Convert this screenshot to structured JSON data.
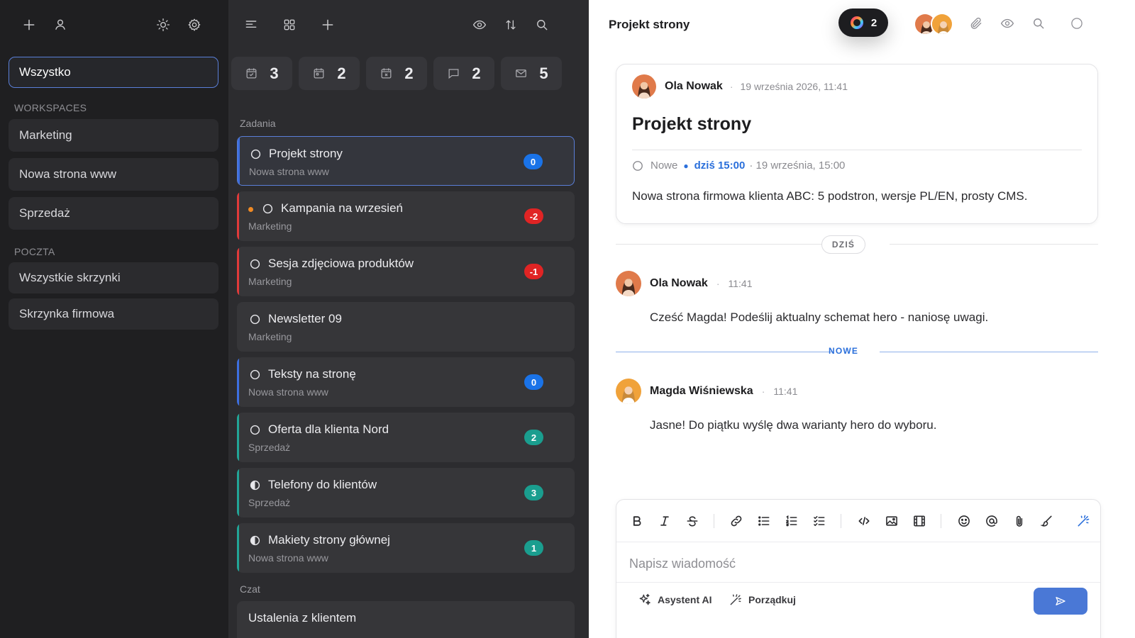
{
  "colors": {
    "accent": "#4a78d6",
    "link": "#2a6fdb",
    "badge_blue": "#1a73e8",
    "badge_red": "#e02424",
    "badge_green": "#1a9e8f",
    "bar_blue": "#3d6fe0",
    "bar_red": "#e03a3a",
    "bar_teal": "#22a597"
  },
  "sidebar": {
    "toolbar_icons": [
      "plus-icon",
      "user-icon",
      "sun-icon",
      "gear-icon"
    ],
    "all_label": "Wszystko",
    "workspaces_title": "WORKSPACES",
    "workspaces": [
      "Marketing",
      "Nowa strona www",
      "Sprzedaż"
    ],
    "mail_title": "POCZTA",
    "mailboxes": [
      "Wszystkie skrzynki",
      "Skrzynka firmowa"
    ]
  },
  "tasklist": {
    "toolbar_icons": [
      "list-icon",
      "grid-icon",
      "plus-icon",
      "eye-icon",
      "sort-icon",
      "search-icon"
    ],
    "stats": [
      {
        "icon": "calendar-check-icon",
        "value": "3"
      },
      {
        "icon": "calendar-icon",
        "value": "2"
      },
      {
        "icon": "calendar-x-icon",
        "value": "2"
      },
      {
        "icon": "comment-icon",
        "value": "2"
      },
      {
        "icon": "mail-icon",
        "value": "5"
      }
    ],
    "tasks_title": "Zadania",
    "tasks": [
      {
        "title": "Projekt strony",
        "subtitle": "Nowa strona www",
        "badge": "0",
        "bar": "blue",
        "badge_color": "blue",
        "status": "open",
        "selected": true
      },
      {
        "title": "Kampania na wrzesień",
        "subtitle": "Marketing",
        "badge": "-2",
        "bar": "red",
        "badge_color": "red",
        "status": "open",
        "dot": true
      },
      {
        "title": "Sesja zdjęciowa produktów",
        "subtitle": "Marketing",
        "badge": "-1",
        "bar": "red",
        "badge_color": "red",
        "status": "open"
      },
      {
        "title": "Newsletter 09",
        "subtitle": "Marketing",
        "badge": "",
        "bar": "",
        "badge_color": "",
        "status": "open"
      },
      {
        "title": "Teksty na stronę",
        "subtitle": "Nowa strona www",
        "badge": "0",
        "bar": "blue",
        "badge_color": "blue",
        "status": "open"
      },
      {
        "title": "Oferta dla klienta Nord",
        "subtitle": "Sprzedaż",
        "badge": "2",
        "bar": "teal",
        "badge_color": "green",
        "status": "open"
      },
      {
        "title": "Telefony do klientów",
        "subtitle": "Sprzedaż",
        "badge": "3",
        "bar": "teal",
        "badge_color": "green",
        "status": "half"
      },
      {
        "title": "Makiety strony głównej",
        "subtitle": "Nowa strona www",
        "badge": "1",
        "bar": "teal",
        "badge_color": "green",
        "status": "half"
      }
    ],
    "chat_title": "Czat",
    "chats": [
      "Ustalenia z klientem"
    ]
  },
  "detail": {
    "header_title": "Projekt strony",
    "online_count": "2",
    "header_icons": [
      "paperclip-icon",
      "eye-icon",
      "search-icon",
      "circle-icon"
    ],
    "card": {
      "author": "Ola Nowak",
      "date": "19 września 2026, 11:41",
      "title": "Projekt strony",
      "status": "Nowe",
      "due_today": "dziś 15:00",
      "due_date": "· 19 września, 15:00",
      "description": "Nowa strona firmowa klienta ABC: 5 podstron, wersje PL/EN, prosty CMS."
    },
    "day_chip": "DZIŚ",
    "new_chip": "NOWE",
    "messages": [
      {
        "author": "Ola Nowak",
        "time": "11:41",
        "text": "Cześć Magda! Podeślij aktualny schemat hero - naniosę uwagi."
      },
      {
        "author": "Magda Wiśniewska",
        "time": "11:41",
        "text": "Jasne! Do piątku wyślę dwa warianty hero do wyboru."
      }
    ],
    "composer": {
      "placeholder": "Napisz wiadomość",
      "ai_label": "Asystent AI",
      "tidy_label": "Porządkuj"
    }
  }
}
